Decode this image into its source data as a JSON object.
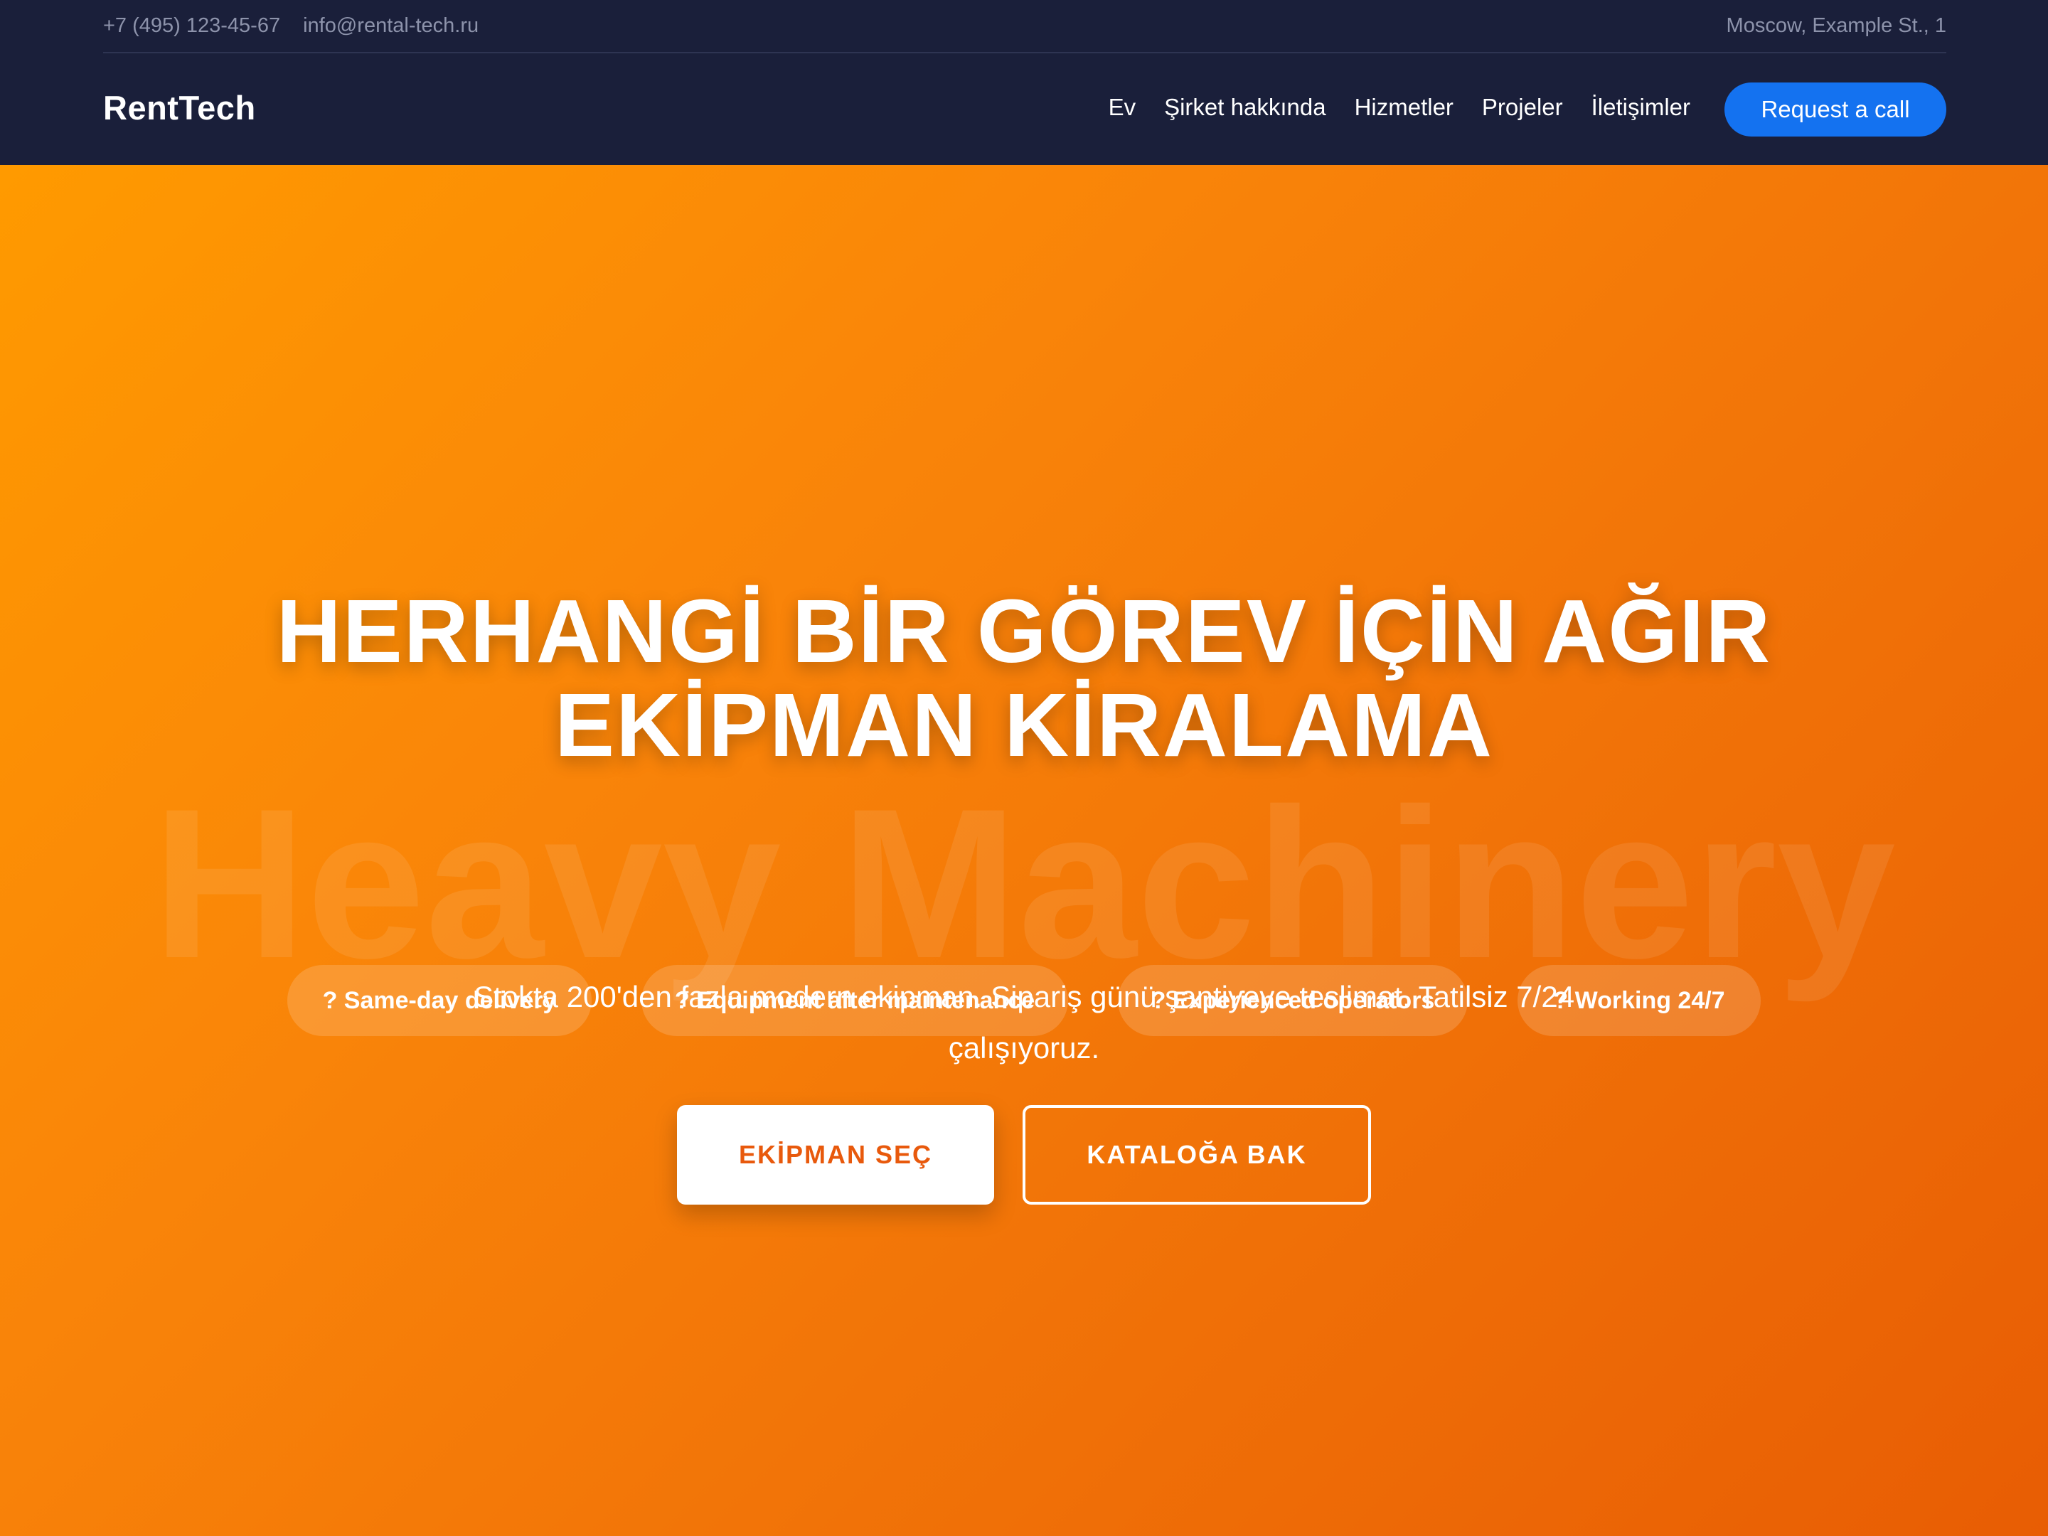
{
  "topbar": {
    "phone": "+7 (495) 123-45-67",
    "email": "info@rental-tech.ru",
    "address": "Moscow, Example St., 1"
  },
  "nav": {
    "logo": "RentTech",
    "links": [
      {
        "label": "Ev"
      },
      {
        "label": "Şirket hakkında"
      },
      {
        "label": "Hizmetler"
      },
      {
        "label": "Projeler"
      },
      {
        "label": "İletişimler"
      }
    ],
    "cta": "Request a call"
  },
  "hero": {
    "watermark": "Heavy Machinery",
    "title_line1": "HERHANGİ BİR GÖREV İÇİN AĞIR",
    "title_line2": "EKİPMAN KİRALAMA",
    "subtitle_line1": "Stokta 200'den fazla modern ekipman. Sipariş günü şantiyeye teslimat. Tatilsiz 7/24",
    "subtitle_line2": "çalışıyoruz.",
    "features": [
      {
        "label": "? Same-day delivery"
      },
      {
        "label": "? Equipment after maintenance"
      },
      {
        "label": "? Experienced operators"
      },
      {
        "label": "? Working 24/7"
      }
    ],
    "primary_button": "EKİPMAN SEÇ",
    "secondary_button": "KATALOĞA BAK"
  },
  "colors": {
    "header_bg": "#1a1f3a",
    "cta_blue": "#1472f0",
    "hero_gradient_start": "#ff9a00",
    "hero_gradient_end": "#e85d04",
    "primary_button_text": "#e8590c"
  }
}
